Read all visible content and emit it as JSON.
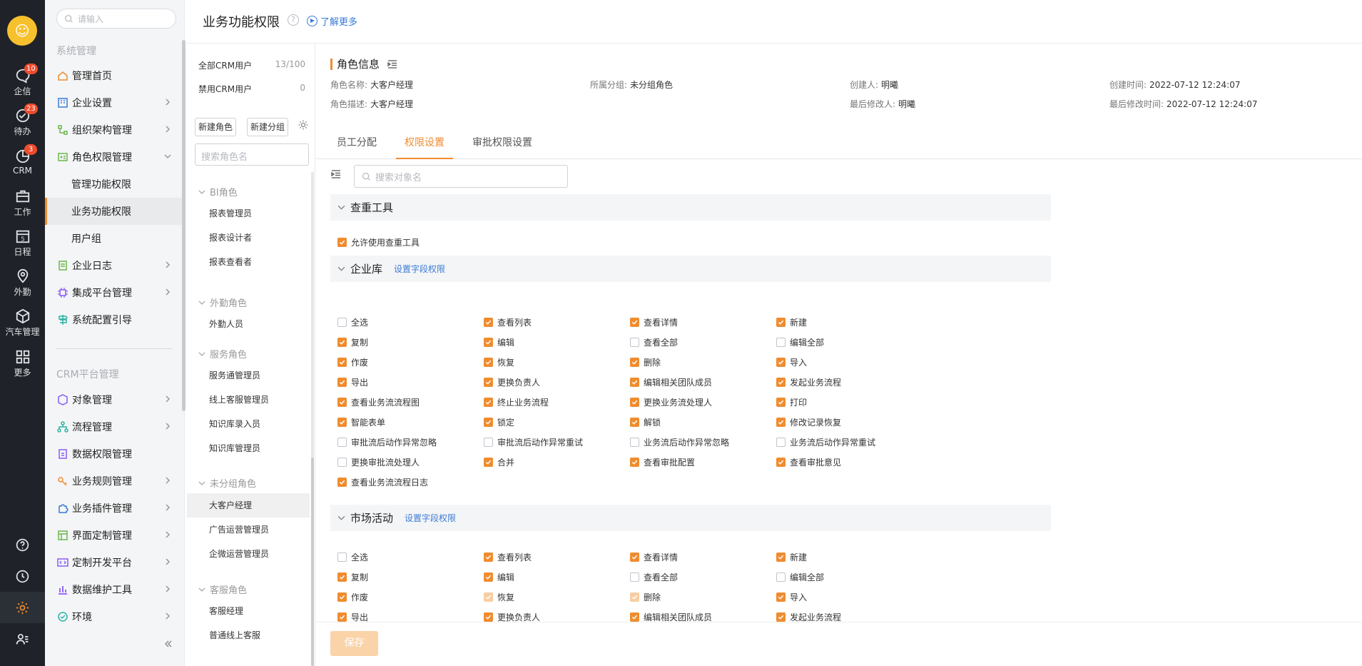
{
  "rail": {
    "items": [
      {
        "label": "企信",
        "badge": "10"
      },
      {
        "label": "待办",
        "badge": "23"
      },
      {
        "label": "CRM",
        "badge": "3"
      },
      {
        "label": "工作",
        "badge": ""
      },
      {
        "label": "日程",
        "badge": ""
      },
      {
        "label": "外勤",
        "badge": ""
      },
      {
        "label": "汽车管理",
        "badge": ""
      },
      {
        "label": "更多",
        "badge": ""
      }
    ]
  },
  "nav": {
    "search_placeholder": "请输入",
    "section1": "系统管理",
    "section2": "CRM平台管理",
    "items": [
      "管理首页",
      "企业设置",
      "组织架构管理",
      "角色权限管理",
      "管理功能权限",
      "业务功能权限",
      "用户组",
      "企业日志",
      "集成平台管理",
      "系统配置引导",
      "对象管理",
      "流程管理",
      "数据权限管理",
      "业务规则管理",
      "业务插件管理",
      "界面定制管理",
      "定制开发平台",
      "数据维护工具",
      "环境"
    ]
  },
  "page": {
    "title": "业务功能权限",
    "help": "?",
    "learn_more": "了解更多"
  },
  "roles": {
    "all_users": "全部CRM用户",
    "all_count": "13/100",
    "disabled_users": "禁用CRM用户",
    "disabled_count": "0",
    "new_role": "新建角色",
    "new_group": "新建分组",
    "search_placeholder": "搜索角色名",
    "groups": [
      {
        "name": "BI角色",
        "roles": [
          "报表管理员",
          "报表设计者",
          "报表查看者"
        ]
      },
      {
        "name": "外勤角色",
        "roles": [
          "外勤人员"
        ]
      },
      {
        "name": "服务角色",
        "roles": [
          "服务通管理员",
          "线上客服管理员",
          "知识库录入员",
          "知识库管理员"
        ]
      },
      {
        "name": "未分组角色",
        "roles": [
          "大客户经理",
          "广告运营管理员",
          "企微运营管理员"
        ]
      },
      {
        "name": "客服角色",
        "roles": [
          "客服经理",
          "普通线上客服"
        ]
      }
    ]
  },
  "info": {
    "title": "角色信息",
    "fields": [
      {
        "k": "角色名称:",
        "v": "大客户经理"
      },
      {
        "k": "所属分组:",
        "v": "未分组角色"
      },
      {
        "k": "创建人:",
        "v": "明曦"
      },
      {
        "k": "创建时间:",
        "v": "2022-07-12 12:24:07"
      },
      {
        "k": "角色描述:",
        "v": "大客户经理"
      },
      {
        "k": "最后修改人:",
        "v": "明曦"
      },
      {
        "k": "最后修改时间:",
        "v": "2022-07-12 12:24:07"
      }
    ]
  },
  "tabs": [
    "员工分配",
    "权限设置",
    "审批权限设置"
  ],
  "obj_search_placeholder": "搜索对象名",
  "sections": [
    {
      "title": "查重工具",
      "field_link": ""
    },
    {
      "title": "企业库",
      "field_link": "设置字段权限"
    },
    {
      "title": "市场活动",
      "field_link": "设置字段权限"
    }
  ],
  "perms": {
    "dup": [
      {
        "l": "允许使用查重工具",
        "s": 1
      }
    ],
    "enterprise": [
      {
        "l": "全选",
        "s": 0
      },
      {
        "l": "查看列表",
        "s": 1
      },
      {
        "l": "查看详情",
        "s": 1
      },
      {
        "l": "新建",
        "s": 1
      },
      {
        "l": "复制",
        "s": 1
      },
      {
        "l": "编辑",
        "s": 1
      },
      {
        "l": "查看全部",
        "s": 0
      },
      {
        "l": "编辑全部",
        "s": 0
      },
      {
        "l": "作废",
        "s": 1
      },
      {
        "l": "恢复",
        "s": 1
      },
      {
        "l": "删除",
        "s": 1
      },
      {
        "l": "导入",
        "s": 1
      },
      {
        "l": "导出",
        "s": 1
      },
      {
        "l": "更换负责人",
        "s": 1
      },
      {
        "l": "编辑相关团队成员",
        "s": 1
      },
      {
        "l": "发起业务流程",
        "s": 1
      },
      {
        "l": "查看业务流流程图",
        "s": 1
      },
      {
        "l": "终止业务流程",
        "s": 1
      },
      {
        "l": "更换业务流处理人",
        "s": 1
      },
      {
        "l": "打印",
        "s": 1
      },
      {
        "l": "智能表单",
        "s": 1
      },
      {
        "l": "锁定",
        "s": 1
      },
      {
        "l": "解锁",
        "s": 1
      },
      {
        "l": "修改记录恢复",
        "s": 1
      },
      {
        "l": "审批流后动作异常忽略",
        "s": 0
      },
      {
        "l": "审批流后动作异常重试",
        "s": 0
      },
      {
        "l": "业务流后动作异常忽略",
        "s": 0
      },
      {
        "l": "业务流后动作异常重试",
        "s": 0
      },
      {
        "l": "更换审批流处理人",
        "s": 0
      },
      {
        "l": "合并",
        "s": 1
      },
      {
        "l": "查看审批配置",
        "s": 1
      },
      {
        "l": "查看审批意见",
        "s": 1
      },
      {
        "l": "查看业务流流程日志",
        "s": 1
      }
    ],
    "market": [
      {
        "l": "全选",
        "s": 0
      },
      {
        "l": "查看列表",
        "s": 1
      },
      {
        "l": "查看详情",
        "s": 1
      },
      {
        "l": "新建",
        "s": 1
      },
      {
        "l": "复制",
        "s": 1
      },
      {
        "l": "编辑",
        "s": 1
      },
      {
        "l": "查看全部",
        "s": 0
      },
      {
        "l": "编辑全部",
        "s": 0
      },
      {
        "l": "作废",
        "s": 1
      },
      {
        "l": "恢复",
        "s": 2
      },
      {
        "l": "删除",
        "s": 2
      },
      {
        "l": "导入",
        "s": 1
      },
      {
        "l": "导出",
        "s": 1
      },
      {
        "l": "更换负责人",
        "s": 1
      },
      {
        "l": "编辑相关团队成员",
        "s": 1
      },
      {
        "l": "发起业务流程",
        "s": 1
      }
    ]
  },
  "save": "保存",
  "colors": {
    "accent": "#f08c2f",
    "link": "#3a7bd5",
    "rail": "#1f2228"
  }
}
